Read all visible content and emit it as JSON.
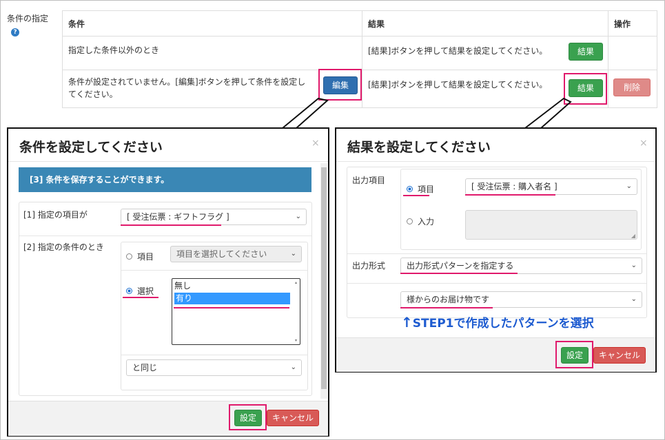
{
  "side": {
    "label": "条件の指定",
    "help_icon": "question-circle-icon"
  },
  "table": {
    "headers": {
      "condition": "条件",
      "result": "結果",
      "ops": "操作"
    },
    "rows": [
      {
        "condition": "指定した条件以外のとき",
        "result": "[結果]ボタンを押して結果を設定してください。",
        "result_btn": "結果"
      },
      {
        "condition": "条件が設定されていません。[編集]ボタンを押して条件を設定してください。",
        "edit_btn": "編集",
        "result": "[結果]ボタンを押して結果を設定してください。",
        "result_btn": "結果",
        "delete_btn": "削除"
      }
    ]
  },
  "left_modal": {
    "title": "条件を設定してください",
    "close": "×",
    "info": "[3] 条件を保存することができます。",
    "item_label": "[1] 指定の項目が",
    "item_value": "[ 受注伝票 : ギフトフラグ ]",
    "cond_label": "[2] 指定の条件のとき",
    "radio_item": "項目",
    "item_select_placeholder": "項目を選択してください",
    "radio_select": "選択",
    "list_options": [
      "無し",
      "有り"
    ],
    "operator": "と同じ",
    "save_btn": "設定",
    "cancel_btn": "キャンセル"
  },
  "right_modal": {
    "title": "結果を設定してください",
    "close": "×",
    "output_item_label": "出力項目",
    "radio_item": "項目",
    "item_value": "[ 受注伝票 : 購入者名 ]",
    "radio_input": "入力",
    "format_label": "出力形式",
    "format_value": "出力形式パターンを指定する",
    "pattern_value": "様からのお届け物です",
    "annotation": "STEP1で作成したパターンを選択",
    "save_btn": "設定",
    "cancel_btn": "キャンセル"
  },
  "colors": {
    "accent": "#e0196b",
    "info_bar": "#3a87b5",
    "selected": "#3399ff",
    "annotation": "#1d5bd0"
  }
}
